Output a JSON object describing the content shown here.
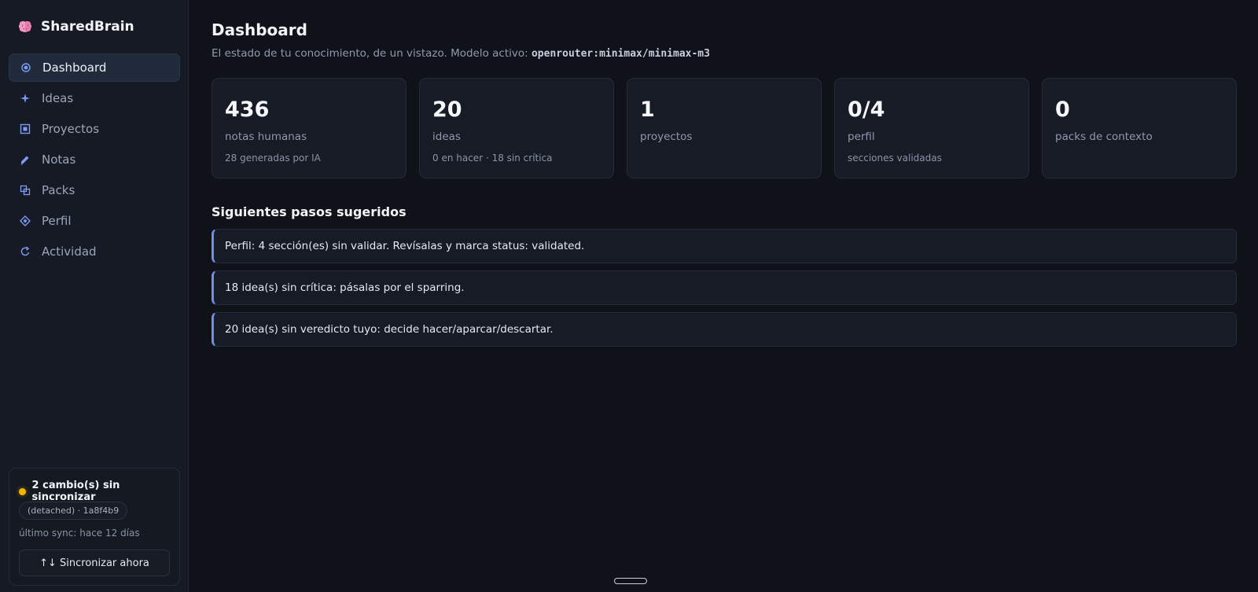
{
  "app": {
    "name": "SharedBrain",
    "icon": "brain-icon"
  },
  "sidebar": {
    "items": [
      {
        "label": "Dashboard",
        "icon": "dashboard-icon",
        "active": true
      },
      {
        "label": "Ideas",
        "icon": "sparkle-icon",
        "active": false
      },
      {
        "label": "Proyectos",
        "icon": "project-square-icon",
        "active": false
      },
      {
        "label": "Notas",
        "icon": "pencil-icon",
        "active": false
      },
      {
        "label": "Packs",
        "icon": "packs-icon",
        "active": false
      },
      {
        "label": "Perfil",
        "icon": "profile-diamond-icon",
        "active": false
      },
      {
        "label": "Actividad",
        "icon": "activity-refresh-icon",
        "active": false
      }
    ]
  },
  "sync": {
    "status": "2 cambio(s) sin sincronizar",
    "status_color": "#f5b400",
    "branch": "(detached) · 1a8f4b9",
    "last_sync": "último sync: hace 12 días",
    "button_label": "↑↓ Sincronizar ahora"
  },
  "main": {
    "title": "Dashboard",
    "subtitle_prefix": "El estado de tu conocimiento, de un vistazo. Modelo activo: ",
    "model": "openrouter:minimax/minimax-m3",
    "stats": [
      {
        "value": "436",
        "label": "notas humanas",
        "sub": "28 generadas por IA"
      },
      {
        "value": "20",
        "label": "ideas",
        "sub": "0 en hacer · 18 sin crítica"
      },
      {
        "value": "1",
        "label": "proyectos",
        "sub": ""
      },
      {
        "value": "0/4",
        "label": "perfil",
        "sub": "secciones validadas"
      },
      {
        "value": "0",
        "label": "packs de contexto",
        "sub": ""
      }
    ],
    "next_steps_title": "Siguientes pasos sugeridos",
    "next_steps": [
      "Perfil: 4 sección(es) sin validar. Revísalas y marca status: validated.",
      "18 idea(s) sin crítica: pásalas por el sparring.",
      "20 idea(s) sin veredicto tuyo: decide hacer/aparcar/descartar."
    ]
  },
  "colors": {
    "accent": "#7d9cf5",
    "step_border": "#6f8ee6",
    "background": "#0f1218",
    "sidebar": "#151a24"
  }
}
